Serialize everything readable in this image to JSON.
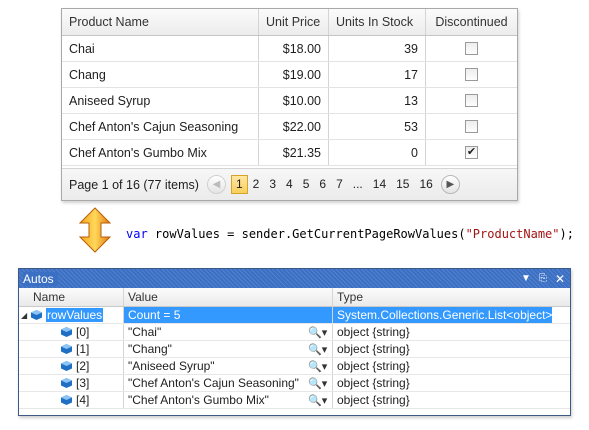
{
  "grid": {
    "columns": [
      "Product Name",
      "Unit Price",
      "Units In Stock",
      "Discontinued"
    ],
    "rows": [
      {
        "name": "Chai",
        "price": "$18.00",
        "stock": "39",
        "discontinued": false
      },
      {
        "name": "Chang",
        "price": "$19.00",
        "stock": "17",
        "discontinued": false
      },
      {
        "name": "Aniseed Syrup",
        "price": "$10.00",
        "stock": "13",
        "discontinued": false
      },
      {
        "name": "Chef Anton's Cajun Seasoning",
        "price": "$22.00",
        "stock": "53",
        "discontinued": false
      },
      {
        "name": "Chef Anton's Gumbo Mix",
        "price": "$21.35",
        "stock": "0",
        "discontinued": true
      }
    ],
    "pager": {
      "info": "Page 1 of 16 (77 items)",
      "pages": [
        "1",
        "2",
        "3",
        "4",
        "5",
        "6",
        "7",
        "...",
        "14",
        "15",
        "16"
      ],
      "current": "1",
      "prev_icon": "chevron-left-icon",
      "next_icon": "chevron-right-icon"
    }
  },
  "code": {
    "keyword": "var",
    "before_string": " rowValues = sender.GetCurrentPageRowValues(",
    "string_literal": "\"ProductName\"",
    "after_string": ");"
  },
  "autos": {
    "title": "Autos",
    "columns": [
      "Name",
      "Value",
      "Type"
    ],
    "root": {
      "name": "rowValues",
      "value": "Count = 5",
      "type": "System.Collections.Generic.List<object>"
    },
    "items": [
      {
        "name": "[0]",
        "value": "\"Chai\"",
        "type": "object {string}"
      },
      {
        "name": "[1]",
        "value": "\"Chang\"",
        "type": "object {string}"
      },
      {
        "name": "[2]",
        "value": "\"Aniseed Syrup\"",
        "type": "object {string}"
      },
      {
        "name": "[3]",
        "value": "\"Chef Anton's Cajun Seasoning\"",
        "type": "object {string}"
      },
      {
        "name": "[4]",
        "value": "\"Chef Anton's Gumbo Mix\"",
        "type": "object {string}"
      }
    ]
  },
  "colors": {
    "selection": "#3399ff",
    "title_bar": "#3b6fc4",
    "keyword": "#0000ff",
    "string": "#a31515",
    "pager_current": "#f8cf5c"
  }
}
